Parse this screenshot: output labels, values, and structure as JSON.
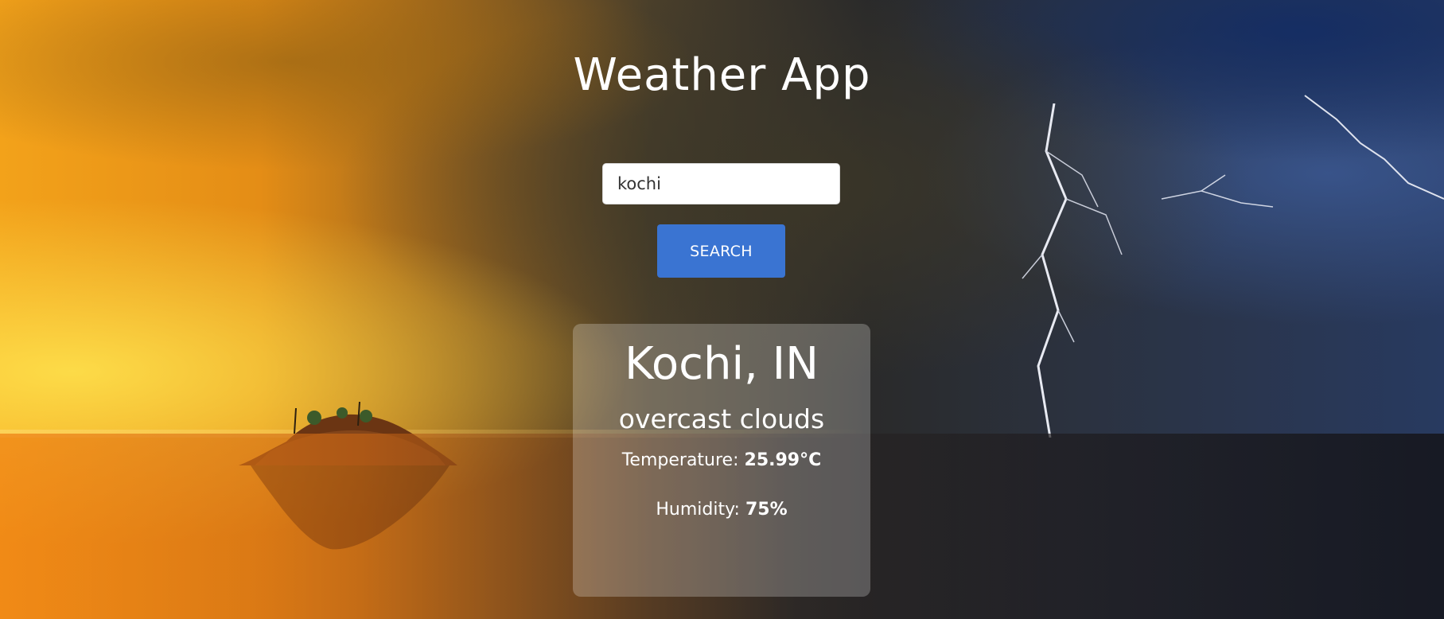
{
  "header": {
    "title": "Weather App"
  },
  "search": {
    "value": "kochi",
    "button_label": "SEARCH"
  },
  "weather": {
    "location": "Kochi, IN",
    "description": "overcast clouds",
    "temperature_label": "Temperature:",
    "temperature_value": "25.99°C",
    "humidity_label": "Humidity:",
    "humidity_value": "75%"
  },
  "colors": {
    "button_bg": "#3a74d2",
    "text": "#ffffff",
    "card_bg": "rgba(255,255,255,0.24)"
  }
}
